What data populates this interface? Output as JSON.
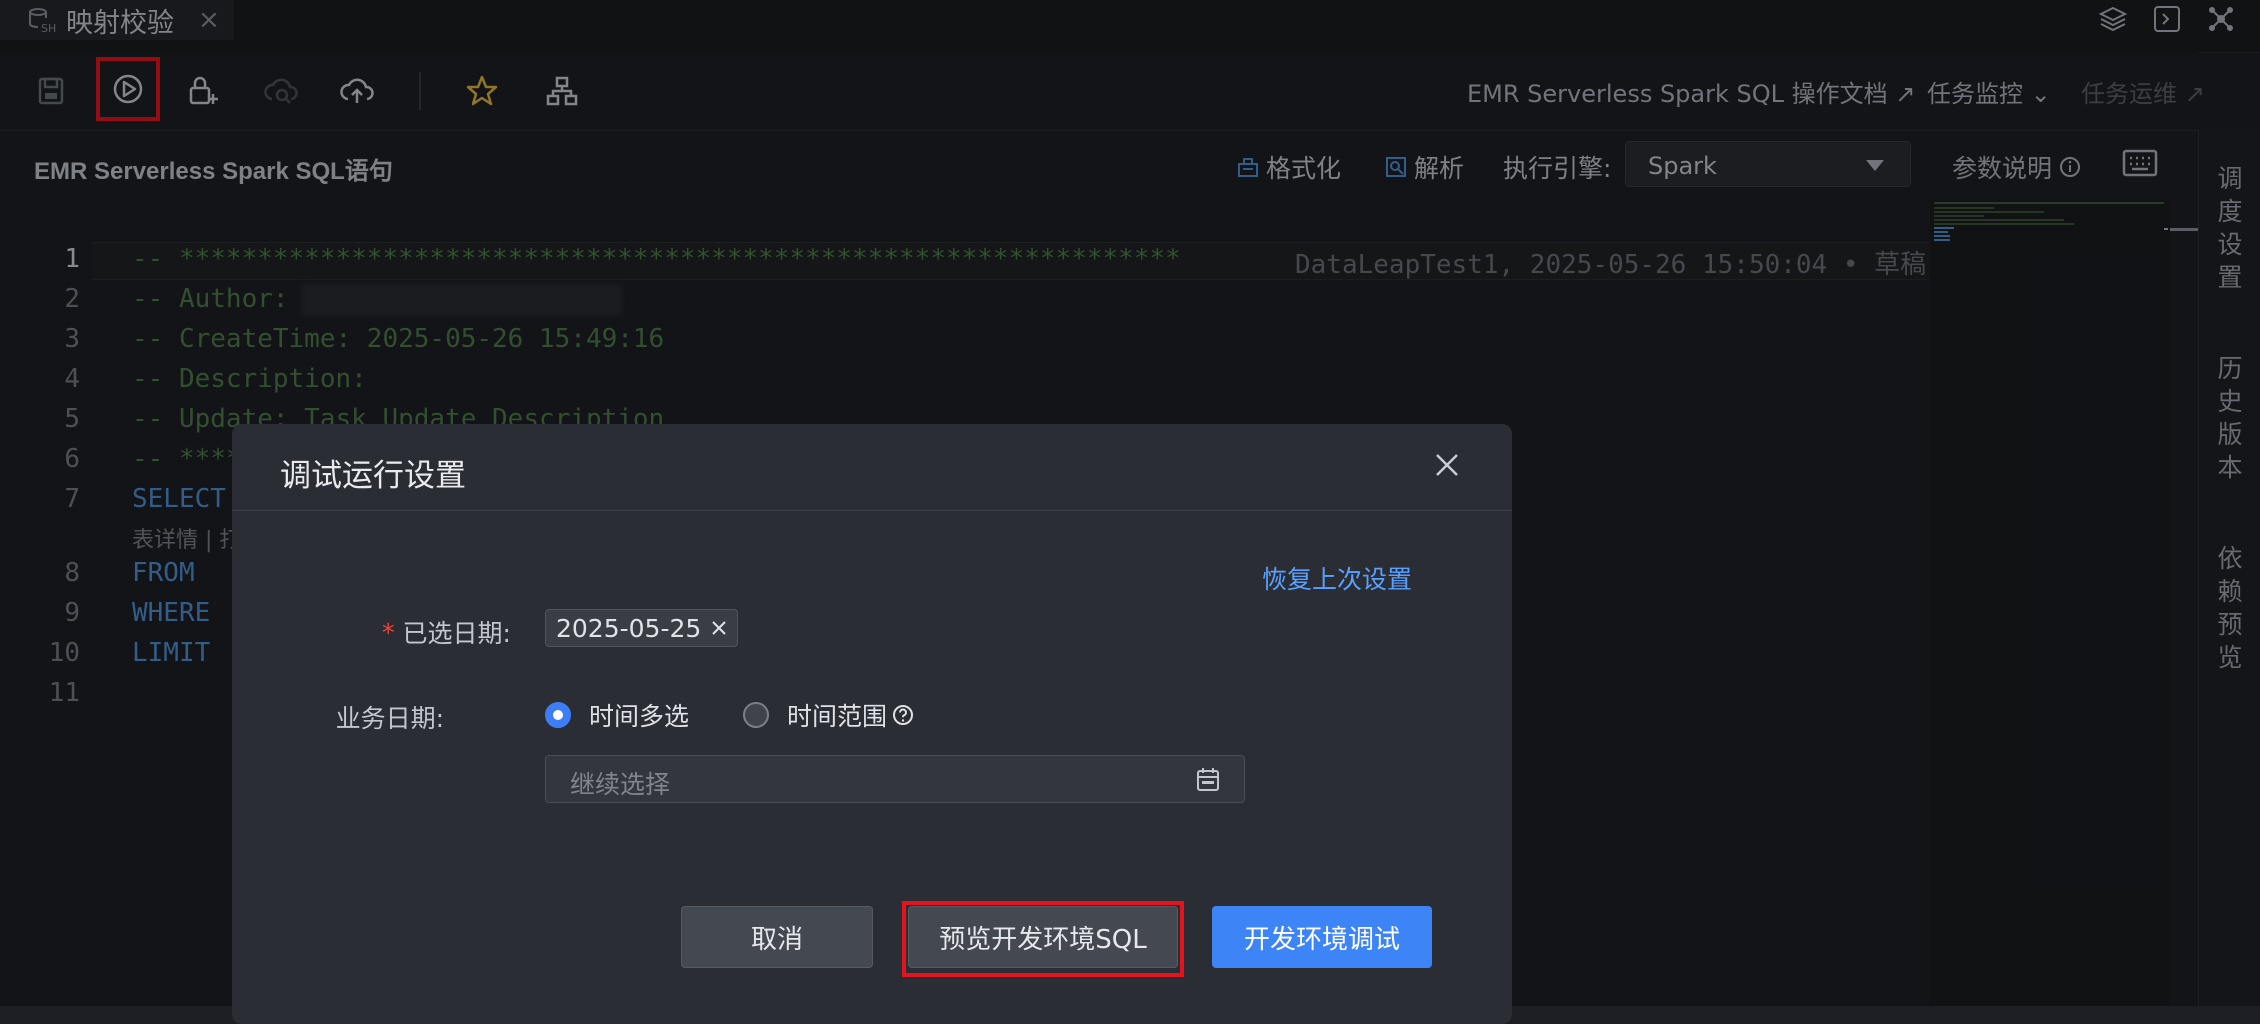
{
  "tab": {
    "title": "映射校验",
    "close": "×"
  },
  "toolbar": {
    "links": [
      {
        "label": "EMR Serverless Spark SQL 操作文档 ↗"
      },
      {
        "label": "任务监控"
      },
      {
        "label": "任务运维 ↗"
      }
    ]
  },
  "editor": {
    "title": "EMR Serverless Spark SQL语句",
    "format_label": "格式化",
    "parse_label": "解析",
    "engine_label": "执行引擎:",
    "engine_value": "Spark",
    "param_label": "参数说明",
    "line_numbers": [
      "1",
      "2",
      "3",
      "4",
      "5",
      "6",
      "7",
      "8",
      "9",
      "10",
      "11"
    ],
    "lines": [
      {
        "text": "-- ****************************************************************",
        "type": "comment"
      },
      {
        "text": "-- Author:",
        "type": "comment"
      },
      {
        "text": "-- CreateTime: 2025-05-26 15:49:16",
        "type": "comment"
      },
      {
        "text": "-- Description:",
        "type": "comment"
      },
      {
        "text": "-- Update: Task Update Description",
        "type": "comment"
      },
      {
        "text": "-- ****",
        "type": "comment"
      },
      {
        "text": "SELECT",
        "type": "keyword"
      },
      {
        "text": "FROM",
        "type": "keyword"
      },
      {
        "text": "WHERE",
        "type": "keyword"
      },
      {
        "text": "LIMIT",
        "type": "keyword"
      },
      {
        "text": "",
        "type": "plain"
      }
    ],
    "inline_blame": "DataLeapTest1, 2025-05-26 15:50:04 • 草稿",
    "table_hint": "表详情 | 打"
  },
  "rail": {
    "items": [
      {
        "label": "调度设置"
      },
      {
        "label": "历史版本"
      },
      {
        "label": "依赖预览"
      }
    ]
  },
  "modal": {
    "title": "调试运行设置",
    "restore_label": "恢复上次设置",
    "selected_date_label": "已选日期:",
    "selected_date_value": "2025-05-25",
    "business_date_label": "业务日期:",
    "option_multi": "时间多选",
    "option_range": "时间范围",
    "date_placeholder": "继续选择",
    "cancel_label": "取消",
    "preview_label": "预览开发环境SQL",
    "debug_label": "开发环境调试"
  },
  "colors": {
    "accent": "#3d85f7",
    "highlight_red": "#e3141d",
    "comment": "#4f7a4a",
    "keyword": "#4f8fd2"
  }
}
